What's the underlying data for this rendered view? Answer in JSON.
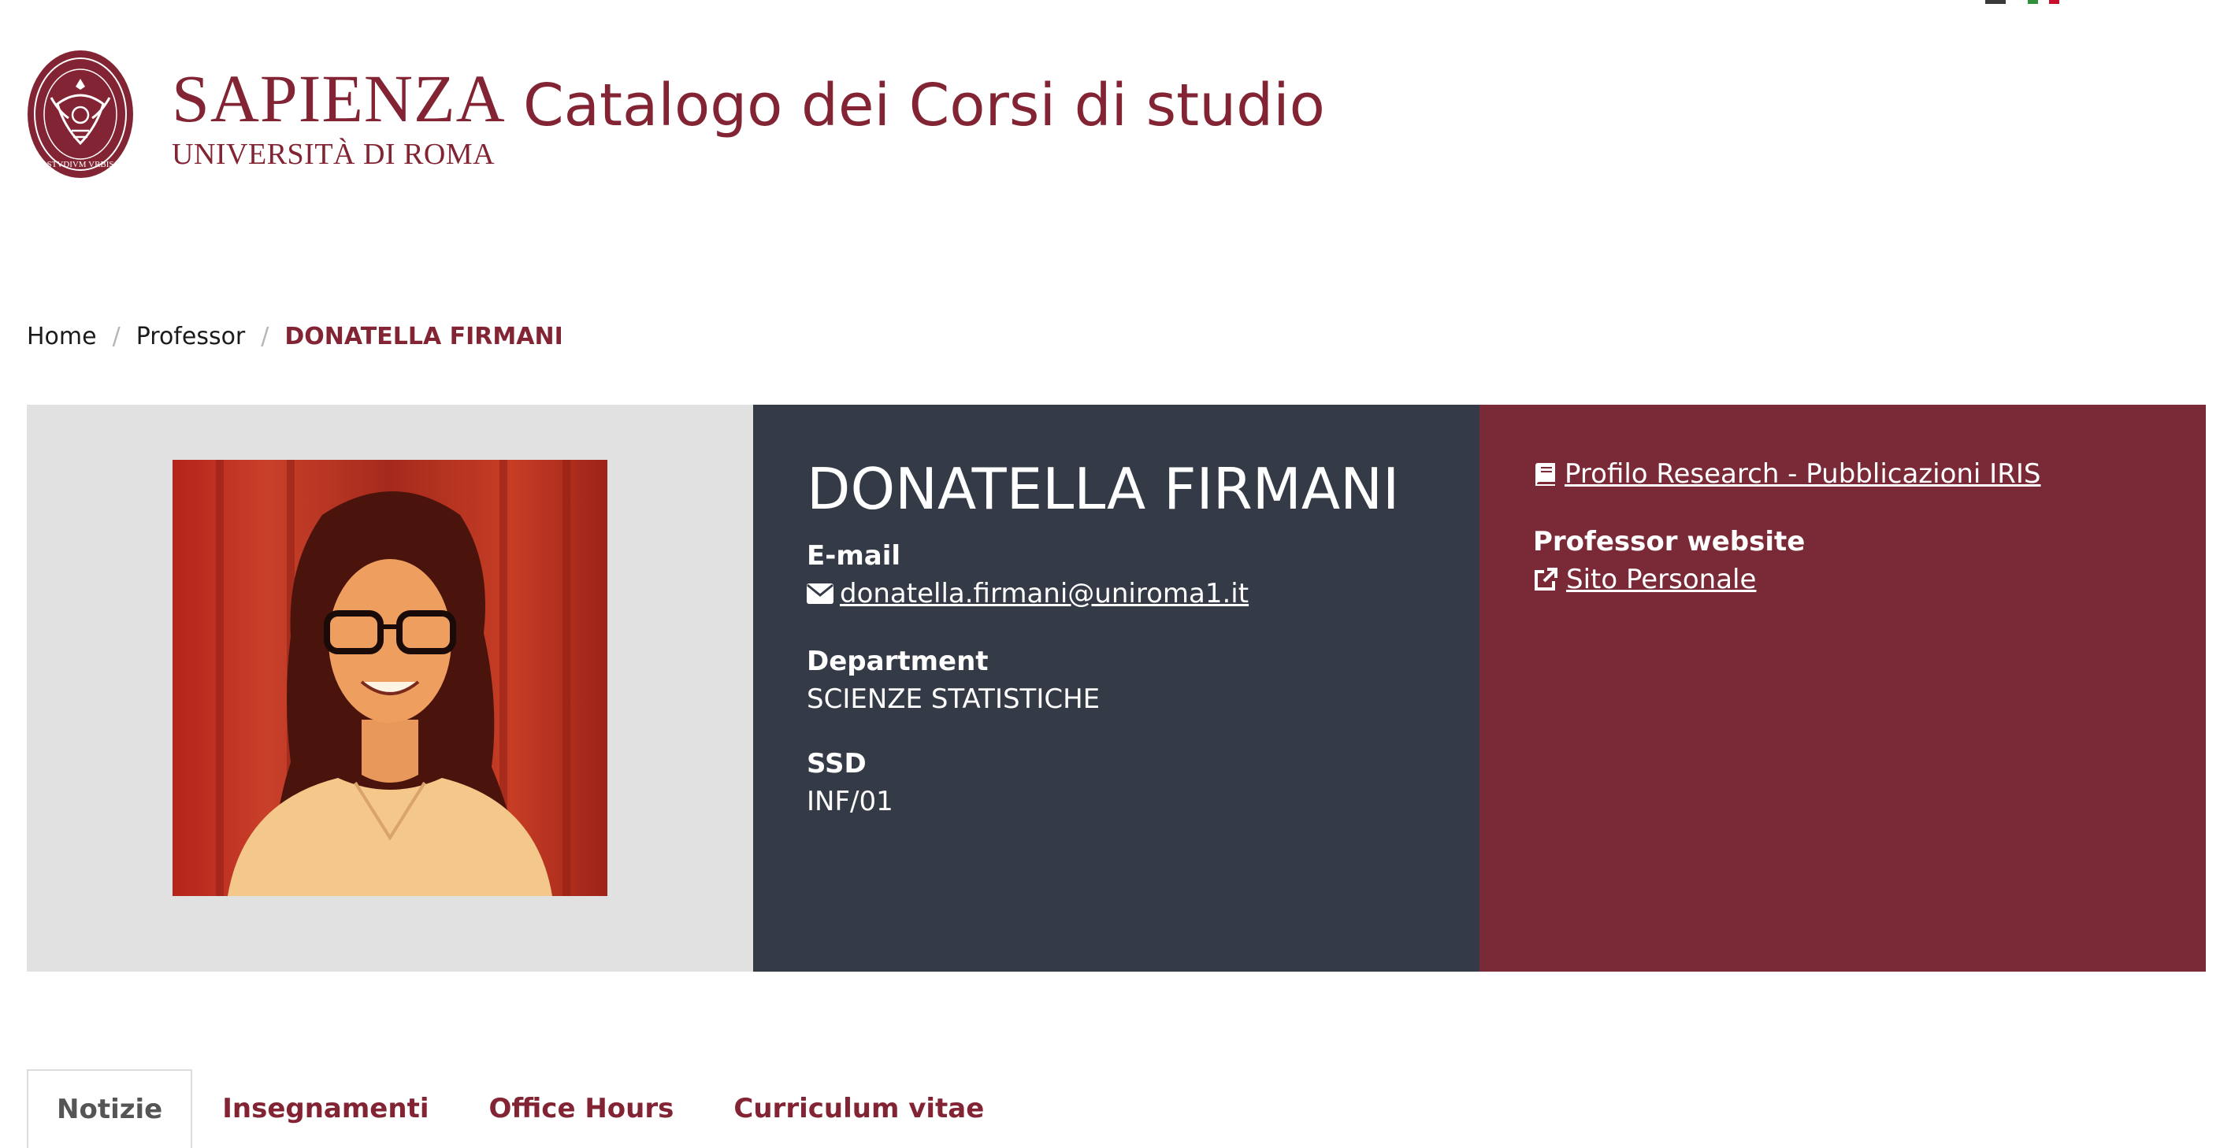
{
  "colors": {
    "brand": "#822433",
    "hero_photo_bg": "#e1e1e1",
    "hero_info_bg": "#353b46",
    "hero_links_bg": "#7a2a36",
    "flag_green": "#2f8f3a",
    "flag_white": "#ffffff",
    "flag_red": "#c8102e"
  },
  "header": {
    "logo_icon": "sapienza-seal-icon",
    "logo_text": "STVDIVM VRBIS",
    "brand_name": "SAPIENZA",
    "brand_sub": "UNIVERSITÀ DI ROMA",
    "site_title": "Catalogo dei Corsi di studio"
  },
  "lang_flags": [
    "english-flag-icon",
    "italian-flag-icon"
  ],
  "breadcrumb": {
    "items": [
      "Home",
      "Professor"
    ],
    "separator": "/",
    "current": "DONATELLA FIRMANI"
  },
  "profile": {
    "photo_icon": "professor-portrait",
    "name": "DONATELLA FIRMANI",
    "email_label": "E-mail",
    "email_icon": "envelope-icon",
    "email": "donatella.firmani@uniroma1.it",
    "department_label": "Department",
    "department": "SCIENZE STATISTICHE",
    "ssd_label": "SSD",
    "ssd": "INF/01"
  },
  "links": {
    "research_icon": "book-icon",
    "research_label": "Profilo Research - Pubblicazioni IRIS",
    "website_label": "Professor website",
    "website_icon": "external-link-icon",
    "website_link": "Sito Personale"
  },
  "tabs": [
    {
      "label": "Notizie",
      "active": true
    },
    {
      "label": "Insegnamenti",
      "active": false
    },
    {
      "label": "Office Hours",
      "active": false
    },
    {
      "label": "Curriculum vitae",
      "active": false
    }
  ]
}
